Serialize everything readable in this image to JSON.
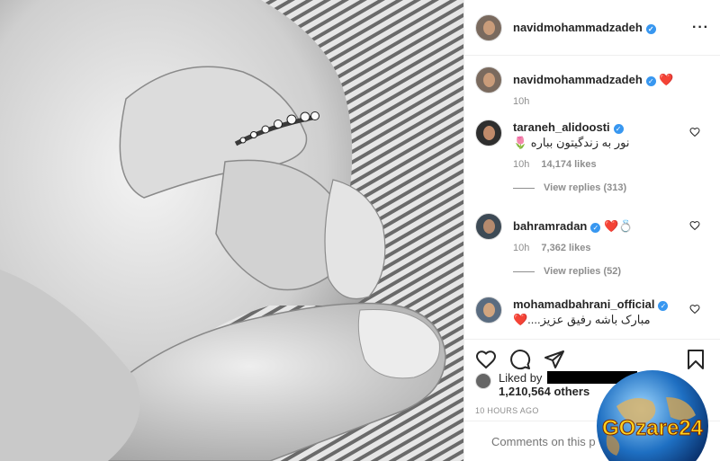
{
  "post": {
    "author": "navidmohammadzadeh",
    "caption_emoji": "❤️",
    "caption_time": "10h"
  },
  "comments": [
    {
      "user": "taraneh_alidoosti",
      "text": "نور به زندگیتون بباره 🌷",
      "time": "10h",
      "likes": "14,174 likes",
      "replies": "View replies (313)"
    },
    {
      "user": "bahramradan",
      "text": "❤️💍",
      "time": "10h",
      "likes": "7,362 likes",
      "replies": "View replies (52)"
    },
    {
      "user": "mohamadbahrani_official",
      "text": "مبارک باشه رفیق عزیز....❤️"
    }
  ],
  "likes": {
    "label": "Liked by",
    "count": "1,210,564 others"
  },
  "timestamp": "10 HOURS AGO",
  "comment_input": {
    "placeholder": "Comments on this p"
  },
  "icons": {
    "more": "more-options-icon",
    "like": "heart-icon",
    "comment": "comment-icon",
    "share": "share-icon",
    "save": "bookmark-icon"
  },
  "watermark": {
    "text": "GOzare24"
  },
  "colors": {
    "verified": "#3897f0",
    "heart": "#ed4956",
    "muted": "#8e8e8e"
  }
}
